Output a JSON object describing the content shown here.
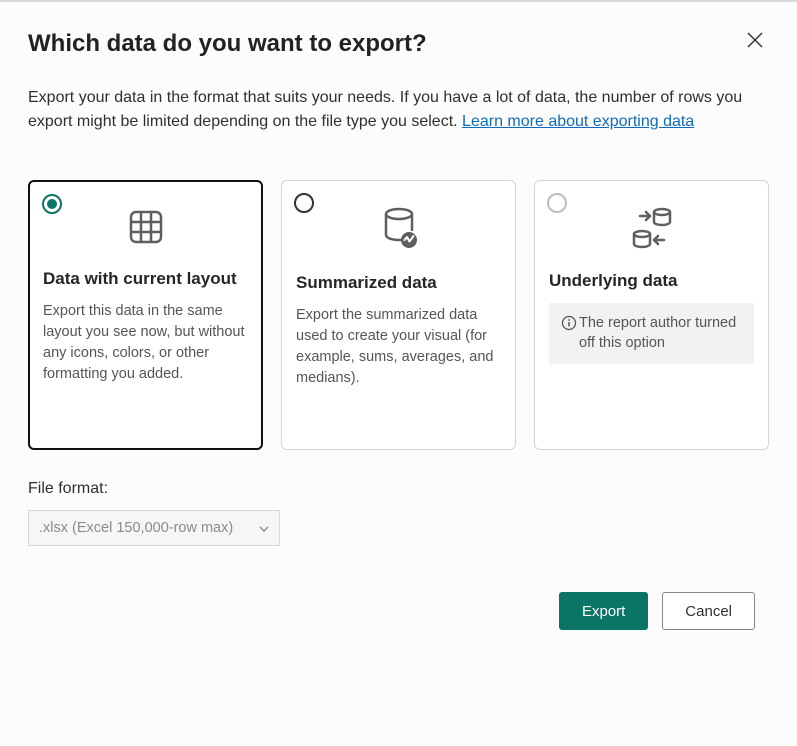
{
  "dialog": {
    "title": "Which data do you want to export?",
    "description_pre": "Export your data in the format that suits your needs. If you have a lot of data, the number of rows you export might be limited depending on the file type you select.  ",
    "learn_more_label": "Learn more about exporting data"
  },
  "options": [
    {
      "title": "Data with current layout",
      "desc": "Export this data in the same layout you see now, but without any icons, colors, or other formatting you added.",
      "selected": true,
      "disabled": false
    },
    {
      "title": "Summarized data",
      "desc": "Export the summarized data used to create your visual (for example, sums, averages, and medians).",
      "selected": false,
      "disabled": false
    },
    {
      "title": "Underlying data",
      "desc": "",
      "disabled_notice": "The report author turned off this option",
      "selected": false,
      "disabled": true
    }
  ],
  "file_format": {
    "label": "File format:",
    "selected": ".xlsx (Excel 150,000-row max)"
  },
  "actions": {
    "export_label": "Export",
    "cancel_label": "Cancel"
  }
}
